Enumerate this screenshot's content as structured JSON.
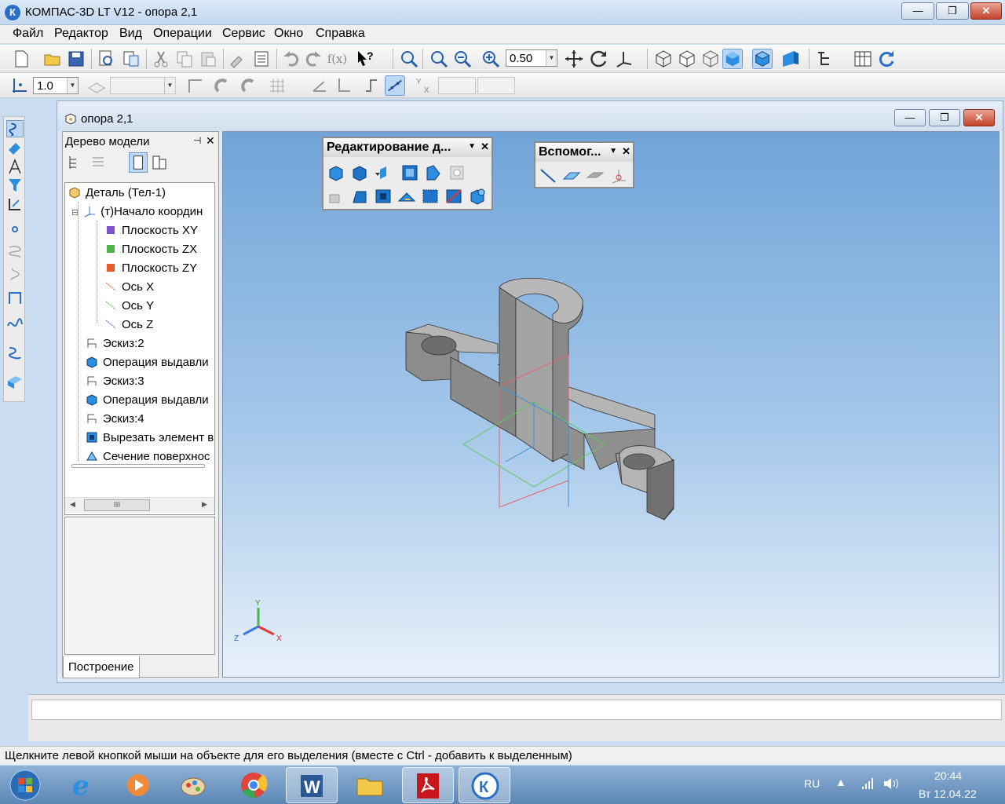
{
  "app": {
    "title": "КОМПАС-3D LT V12 - опора 2,1",
    "logo_letter": "К"
  },
  "window_controls": {
    "minimize": "—",
    "restore": "❐",
    "close": "✕"
  },
  "menu": [
    "Файл",
    "Редактор",
    "Вид",
    "Операции",
    "Сервис",
    "Окно",
    "Справка"
  ],
  "toolbar1": {
    "zoom_value": "0.50",
    "icons": [
      "new-icon",
      "open-icon",
      "save-icon",
      "print-preview-icon",
      "paste-special-icon",
      "cut-icon",
      "copy-icon",
      "paste-icon",
      "properties-icon",
      "list-icon",
      "undo-icon",
      "redo-icon",
      "function-icon",
      "help-pointer-icon",
      "zoom-window-icon",
      "zoom-in-icon",
      "zoom-out-icon",
      "zoom-scale-icon",
      "pan-icon",
      "rotate-icon",
      "orientation-icon",
      "wireframe-icon",
      "hidden-lines-icon",
      "halftone-icon",
      "shaded-icon",
      "shaded-edges-icon",
      "perspective-icon",
      "tree-icon",
      "refresh-icon"
    ]
  },
  "toolbar2": {
    "step_value": "1.0"
  },
  "document": {
    "title": "опора 2,1"
  },
  "tree": {
    "title": "Дерево модели",
    "items": [
      {
        "label": "Деталь (Тел-1)",
        "icon": "part-icon"
      },
      {
        "label": "(т)Начало координ",
        "icon": "origin-icon"
      },
      {
        "label": "Плоскость XY",
        "icon": "plane-xy-icon"
      },
      {
        "label": "Плоскость ZX",
        "icon": "plane-zx-icon"
      },
      {
        "label": "Плоскость ZY",
        "icon": "plane-zy-icon"
      },
      {
        "label": "Ось X",
        "icon": "axis-x-icon"
      },
      {
        "label": "Ось Y",
        "icon": "axis-y-icon"
      },
      {
        "label": "Ось Z",
        "icon": "axis-z-icon"
      },
      {
        "label": "Эскиз:2",
        "icon": "sketch-icon"
      },
      {
        "label": "Операция выдавли",
        "icon": "extrude-icon"
      },
      {
        "label": "Эскиз:3",
        "icon": "sketch-icon"
      },
      {
        "label": "Операция выдавли",
        "icon": "extrude-icon"
      },
      {
        "label": "Эскиз:4",
        "icon": "sketch-icon"
      },
      {
        "label": "Вырезать элемент в",
        "icon": "cut-extrude-icon"
      },
      {
        "label": "Сечение поверхнос",
        "icon": "section-icon"
      }
    ],
    "tab_label": "Построение",
    "scroll_grip": "III"
  },
  "palettes": {
    "edit_title": "Редактирование д...",
    "aux_title": "Вспомог..."
  },
  "axes": {
    "x": "X",
    "y": "Y",
    "z": "Z"
  },
  "status": {
    "hint": "Щелкните левой кнопкой мыши на объекте для его выделения (вместе с Ctrl - добавить к выделенным)"
  },
  "taskbar": {
    "language": "RU",
    "time": "20:44",
    "date": "Вт 12.04.22",
    "apps": [
      "start-orb-icon",
      "ie-icon",
      "media-player-icon",
      "paint-icon",
      "chrome-icon",
      "word-icon",
      "explorer-icon",
      "acrobat-icon",
      "kompas-icon"
    ]
  }
}
